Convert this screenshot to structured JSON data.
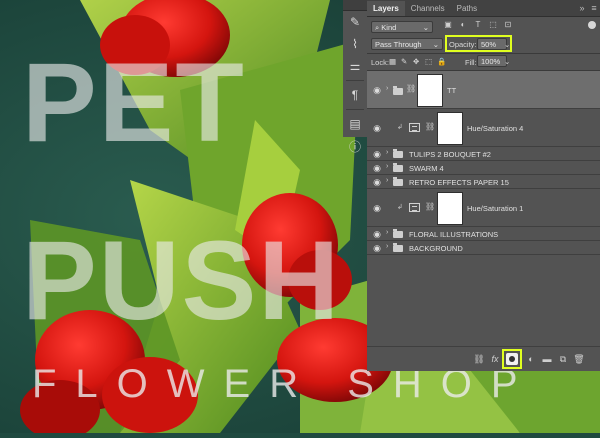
{
  "artwork": {
    "line1": "PET",
    "line2": "PUSH",
    "line3": "FLOWER SHOP"
  },
  "tools": {
    "icons": [
      "paths-sym-icon",
      "brush-settings-icon",
      "adjust-icon",
      "paragraph-icon",
      "layer-comps-icon",
      "info-icon"
    ]
  },
  "panel": {
    "tabs": [
      "Layers",
      "Channels",
      "Paths"
    ],
    "active_tab": "Layers",
    "filter_kind": "Kind",
    "blend_mode": "Pass Through",
    "opacity_label": "Opacity:",
    "opacity_value": "50%",
    "lock_label": "Lock:",
    "fill_label": "Fill:",
    "fill_value": "100%",
    "highlight_color": "#e0ff1f",
    "layers": [
      {
        "name": "TT",
        "type": "group-mask",
        "selected": true
      },
      {
        "name": "Hue/Saturation 4",
        "type": "adjustment"
      },
      {
        "name": "TULIPS 2 BOUQUET #2",
        "type": "group"
      },
      {
        "name": "SWARM 4",
        "type": "group"
      },
      {
        "name": "RETRO EFFECTS PAPER 15",
        "type": "group"
      },
      {
        "name": "Hue/Saturation 1",
        "type": "adjustment"
      },
      {
        "name": "FLORAL ILLUSTRATIONS",
        "type": "group"
      },
      {
        "name": "BACKGROUND",
        "type": "group"
      }
    ],
    "footer_icons": [
      "link-icon",
      "fx-icon",
      "add-mask-icon",
      "adjustment-layer-icon",
      "new-group-icon",
      "new-layer-icon",
      "trash-icon"
    ],
    "fx_label": "fx"
  }
}
